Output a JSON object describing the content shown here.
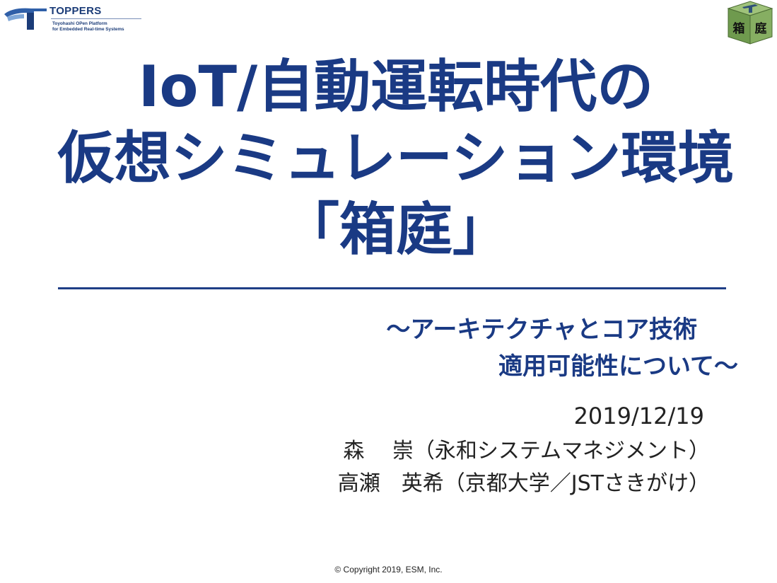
{
  "logo": {
    "name": "TOPPERS",
    "subtitle_line1": "Toyohashi OPen Platform",
    "subtitle_line2": "for Embedded Real-time Systems"
  },
  "badge": {
    "char1": "箱",
    "char2": "庭"
  },
  "title": {
    "line1": "IoT/自動運転時代の",
    "line2": "仮想シミュレーション環境",
    "line3": "「箱庭」"
  },
  "subtitle": {
    "line1": "～アーキテクチャとコア技術",
    "line2": "適用可能性について～"
  },
  "date": "2019/12/19",
  "authors": [
    "森　 崇（永和システムマネジメント）",
    "高瀬　英希（京都大学／JSTさきがけ）"
  ],
  "copyright": "©  Copyright 2019, ESM, Inc.",
  "colors": {
    "title": "#1a3a84",
    "rule": "#1f3e86",
    "badge_green": "#6f9a4e"
  }
}
